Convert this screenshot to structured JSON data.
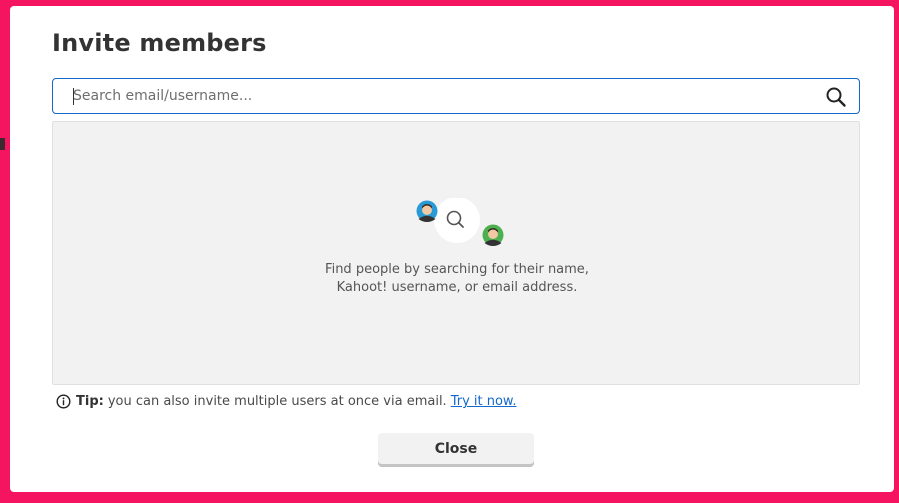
{
  "dialog": {
    "title": "Invite members"
  },
  "search": {
    "placeholder": "Search email/username...",
    "value": "",
    "icon": "search-icon"
  },
  "empty_state": {
    "illustration": "people-search-illustration",
    "line1": "Find people by searching for their name,",
    "line2": "Kahoot! username, or email address."
  },
  "tip": {
    "icon": "info-icon",
    "label": "Tip:",
    "text": "you can also invite multiple users at once via email.",
    "link": "Try it now."
  },
  "footer": {
    "close_label": "Close"
  },
  "colors": {
    "backdrop": "#f5145f",
    "accent": "#1368ce",
    "panel": "#f2f2f2",
    "avatar_blue": "#2a9ad6",
    "avatar_green": "#4caf50"
  }
}
